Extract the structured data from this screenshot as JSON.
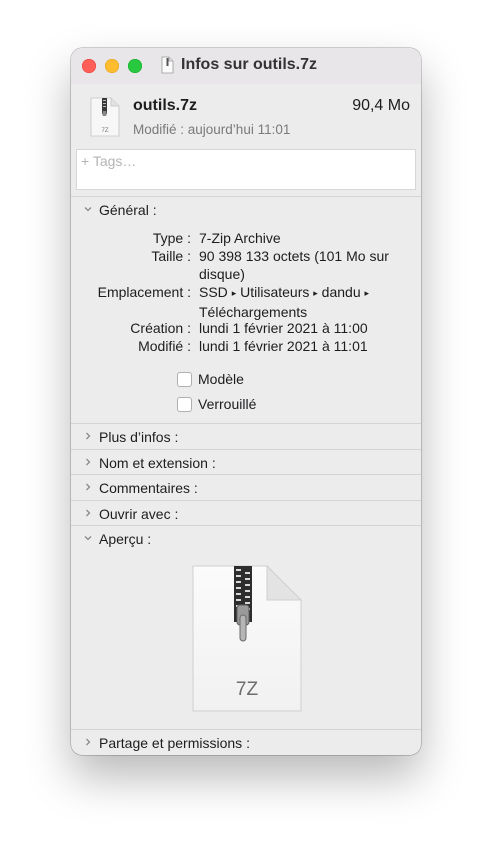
{
  "window": {
    "title": "Infos sur outils.7z"
  },
  "file": {
    "name": "outils.7z",
    "size": "90,4 Mo",
    "modified": "Modifié : aujourd’hui 11:01",
    "icon_label": "7Z"
  },
  "tags": {
    "placeholder": "+ Tags…"
  },
  "general": {
    "label": "Général :",
    "rows": [
      {
        "key": "Type :",
        "value": "7-Zip Archive"
      },
      {
        "key": "Taille :",
        "value": "90 398 133 octets (101 Mo sur disque)"
      },
      {
        "key": "Emplacement :",
        "value_parts": [
          "SSD",
          "Utilisateurs",
          "dandu",
          "Téléchargements"
        ]
      },
      {
        "key": "Création :",
        "value": "lundi 1 février 2021 à 11:00"
      },
      {
        "key": "Modifié :",
        "value": "lundi 1 février 2021 à 11:01"
      }
    ],
    "checkboxes": [
      {
        "label": "Modèle",
        "checked": false
      },
      {
        "label": "Verrouillé",
        "checked": false
      }
    ]
  },
  "sections": [
    {
      "label": "Plus d’infos :"
    },
    {
      "label": "Nom et extension :"
    },
    {
      "label": "Commentaires :"
    },
    {
      "label": "Ouvrir avec :"
    }
  ],
  "preview": {
    "label": "Aperçu :",
    "icon_label": "7Z"
  },
  "sharing": {
    "label": "Partage et permissions :"
  },
  "icons": {
    "window_doc": "document-icon",
    "file": "zip-archive-icon",
    "chevron_right": "chevron-right-icon",
    "chevron_down": "chevron-down-icon"
  },
  "colors": {
    "close": "#ff5f57",
    "minimize": "#febc2e",
    "maximize": "#28c840"
  }
}
